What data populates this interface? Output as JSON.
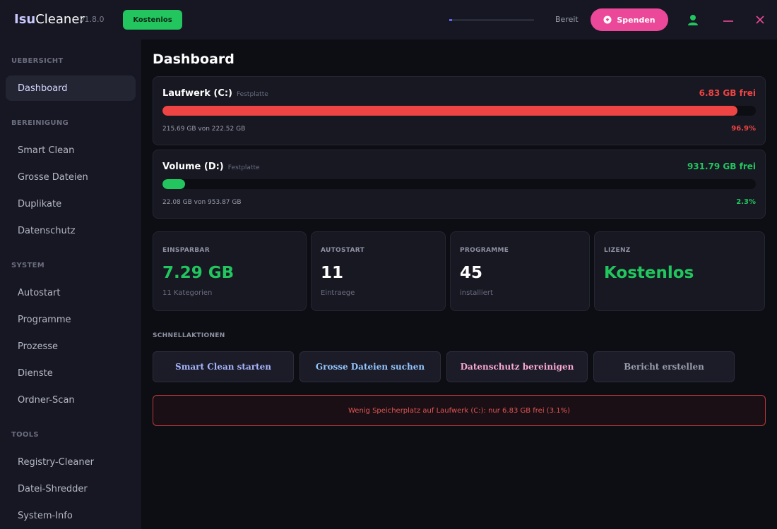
{
  "app": {
    "name_part1": "Isu",
    "name_part2": "Cleaner",
    "version": "v1.8.0",
    "plan_badge": "Kostenlos",
    "status": "Bereit",
    "progress": 0.03,
    "donate_label": "Spenden",
    "colors": {
      "accent": "#6366f1",
      "green": "#22c55e",
      "red": "#ef4444",
      "pink": "#ec4899"
    }
  },
  "sidebar": {
    "sections": [
      {
        "title": "UEBERSICHT",
        "items": [
          {
            "label": "Dashboard",
            "active": true
          }
        ]
      },
      {
        "title": "BEREINIGUNG",
        "items": [
          {
            "label": "Smart Clean"
          },
          {
            "label": "Grosse Dateien"
          },
          {
            "label": "Duplikate"
          },
          {
            "label": "Datenschutz"
          }
        ]
      },
      {
        "title": "SYSTEM",
        "items": [
          {
            "label": "Autostart"
          },
          {
            "label": "Programme"
          },
          {
            "label": "Prozesse"
          },
          {
            "label": "Dienste"
          },
          {
            "label": "Ordner-Scan"
          }
        ]
      },
      {
        "title": "TOOLS",
        "items": [
          {
            "label": "Registry-Cleaner"
          },
          {
            "label": "Datei-Shredder"
          },
          {
            "label": "System-Info"
          }
        ]
      }
    ]
  },
  "main": {
    "title": "Dashboard",
    "drives": [
      {
        "name": "Laufwerk (C:)",
        "type": "Festplatte",
        "free": "6.83 GB frei",
        "usage": "215.69 GB von 222.52 GB",
        "percent_label": "96.9%",
        "fill": 0.969,
        "color": "#ef4444"
      },
      {
        "name": "Volume (D:)",
        "type": "Festplatte",
        "free": "931.79 GB frei",
        "usage": "22.08 GB von 953.87 GB",
        "percent_label": "2.3%",
        "fill": 0.023,
        "color": "#22c55e"
      }
    ],
    "stats": [
      {
        "label": "EINSPARBAR",
        "value": "7.29 GB",
        "sub": "11 Kategorien",
        "color": "#22c55e"
      },
      {
        "label": "AUTOSTART",
        "value": "11",
        "sub": "Eintraege",
        "color": "#ffffff"
      },
      {
        "label": "PROGRAMME",
        "value": "45",
        "sub": "installiert",
        "color": "#ffffff"
      },
      {
        "label": "LIZENZ",
        "value": "Kostenlos",
        "sub": "",
        "color": "#22c55e"
      }
    ],
    "quick_actions_title": "SCHNELLAKTIONEN",
    "quick_actions": [
      {
        "label": "Smart Clean starten",
        "color": "#a5b4fc"
      },
      {
        "label": "Grosse Dateien suchen",
        "color": "#93c5fd"
      },
      {
        "label": "Datenschutz bereinigen",
        "color": "#f9a8d4"
      },
      {
        "label": "Bericht erstellen",
        "color": "#9a9cab"
      }
    ],
    "alert": "Wenig Speicherplatz auf Laufwerk (C:): nur 6.83 GB frei (3.1%)"
  }
}
